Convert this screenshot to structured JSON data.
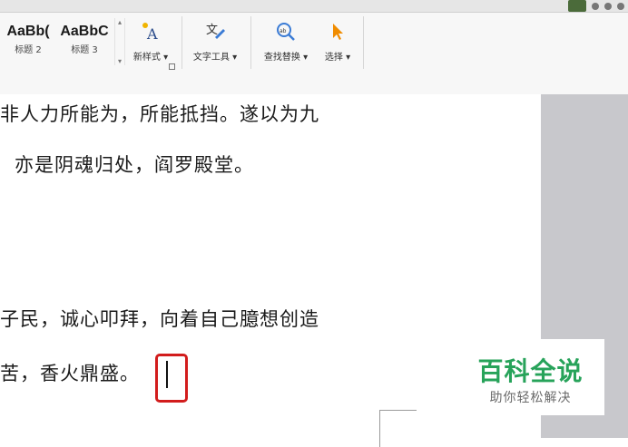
{
  "ribbon": {
    "styles": [
      {
        "sample": "AaBb(",
        "label": "标题 2"
      },
      {
        "sample": "AaBbC",
        "label": "标题 3"
      }
    ],
    "tools": {
      "new_style": "新样式",
      "text_tools": "文字工具",
      "find_replace": "查找替换",
      "select": "选择"
    }
  },
  "document": {
    "lines": [
      "非人力所能为，所能抵挡。遂以为九",
      "亦是阴魂归处，阎罗殿堂。",
      "子民，诚心叩拜，向着自己臆想创造",
      "苦，香火鼎盛。"
    ]
  },
  "watermark": {
    "title": "百科全说",
    "subtitle": "助你轻松解决"
  },
  "colors": {
    "accent_red": "#d21c1c",
    "brand_green": "#27a35a",
    "side_gray": "#c8c8cc"
  }
}
